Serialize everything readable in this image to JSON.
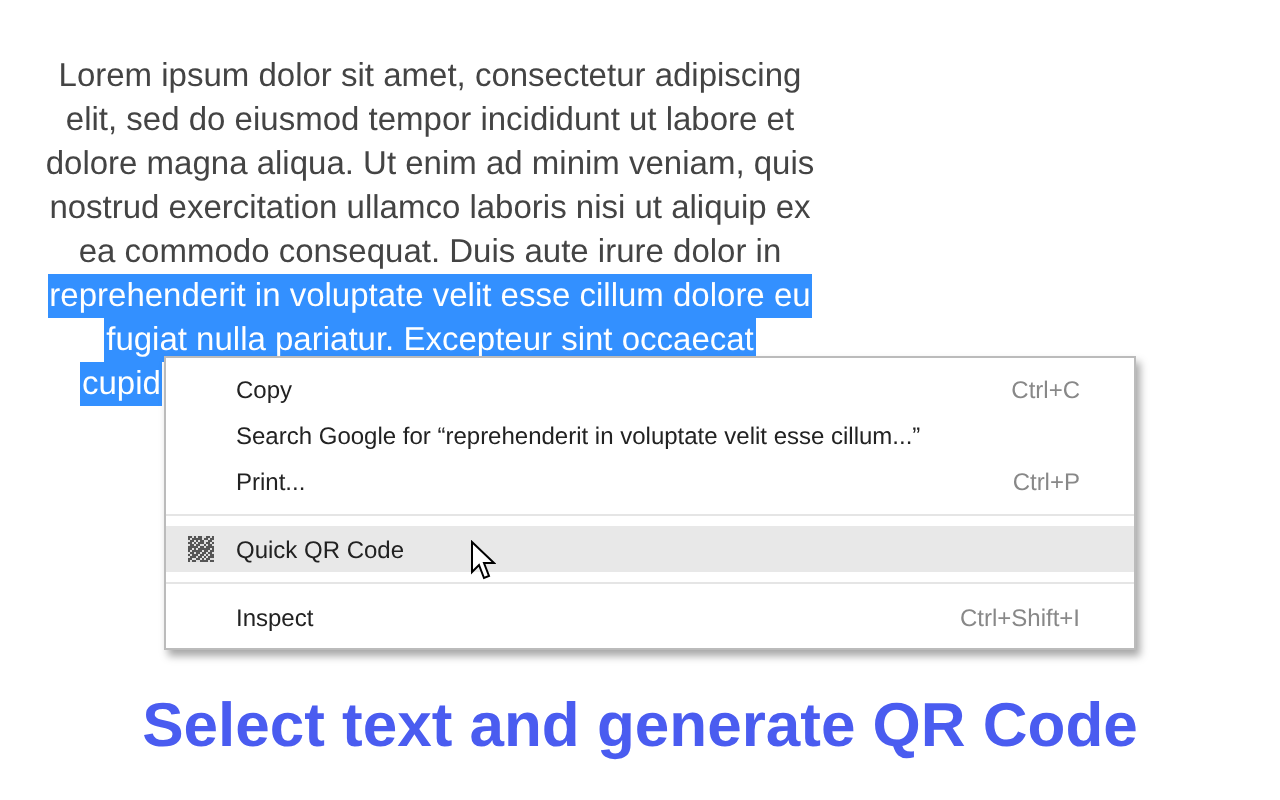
{
  "paragraph": [
    {
      "text": "Lorem ipsum dolor sit amet, consectetur adipiscing",
      "selected": false
    },
    {
      "text": "elit, sed do eiusmod tempor incididunt ut labore et",
      "selected": false
    },
    {
      "text": "dolore magna aliqua. Ut enim ad minim veniam, quis",
      "selected": false
    },
    {
      "text": "nostrud exercitation ullamco laboris nisi ut aliquip ex",
      "selected": false
    },
    {
      "text": "ea commodo consequat. Duis aute irure dolor in",
      "selected": false
    },
    {
      "text": "reprehenderit in voluptate velit esse cillum dolore eu",
      "selected": true
    },
    {
      "text": "fugiat nulla pariatur. Excepteur sint occaecat",
      "selected": true
    },
    {
      "text": "cupid",
      "selected": true
    }
  ],
  "context_menu": [
    {
      "kind": "item",
      "label": "Copy",
      "shortcut": "Ctrl+C",
      "selected": false
    },
    {
      "kind": "item",
      "label": "Search Google for “reprehenderit in voluptate velit esse cillum...”",
      "selected": false
    },
    {
      "kind": "item",
      "label": "Print...",
      "shortcut": "Ctrl+P",
      "selected": false
    },
    {
      "kind": "divider"
    },
    {
      "kind": "qr_item",
      "label": "Quick QR Code",
      "selected": true
    },
    {
      "kind": "divider"
    },
    {
      "kind": "item",
      "label": "Inspect",
      "shortcut": "Ctrl+Shift+I",
      "selected": false
    }
  ],
  "caption": "Select text and generate QR Code"
}
